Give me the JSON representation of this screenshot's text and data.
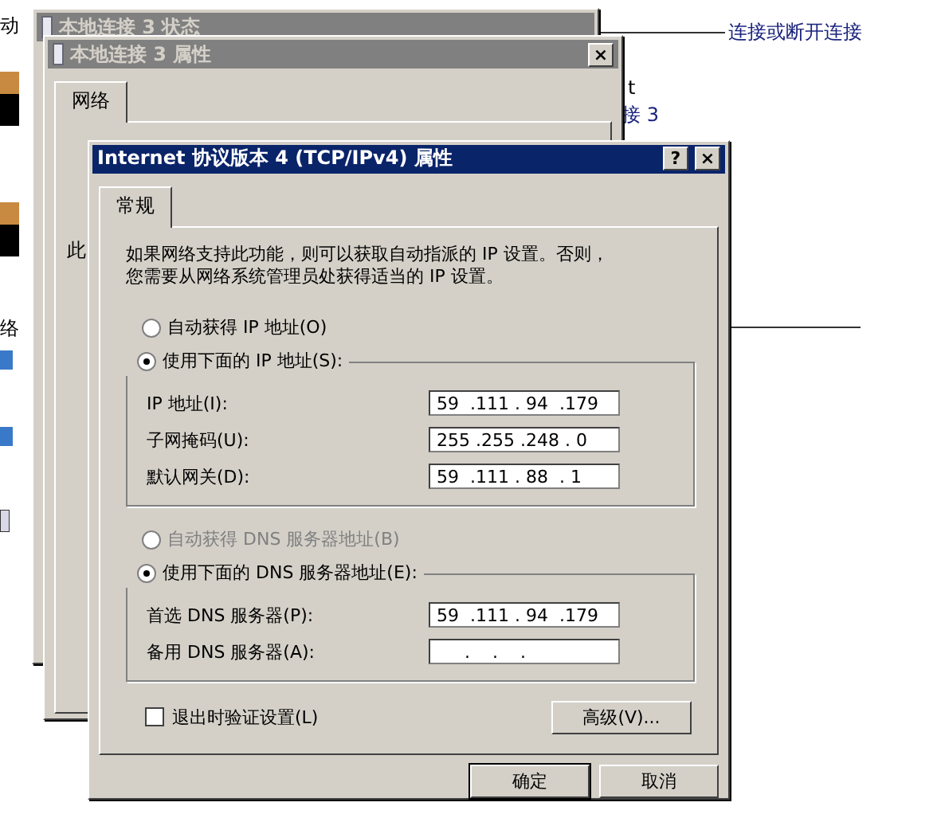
{
  "background_windows": [
    {
      "title": "本地连接 3 状态"
    },
    {
      "title": "本地连接 3 属性",
      "tabs": [
        {
          "label": "网络",
          "selected": true
        }
      ]
    }
  ],
  "background_fragments": {
    "left": [
      "动",
      "络"
    ],
    "right": [
      "t",
      "接 3"
    ],
    "inner": "此"
  },
  "callout": {
    "text": "连接或断开连接"
  },
  "dialog": {
    "title": "Internet 协议版本 4 (TCP/IPv4) 属性",
    "help": "?",
    "close": "×",
    "tabs": [
      {
        "label": "常规",
        "selected": true
      }
    ],
    "description": [
      "如果网络支持此功能，则可以获取自动指派的 IP 设置。否则，",
      "您需要从网络系统管理员处获得适当的 IP 设置。"
    ],
    "ip_options": [
      {
        "label": "自动获得 IP 地址(O)",
        "selected": false,
        "disabled": false
      },
      {
        "label": "使用下面的 IP 地址(S):",
        "selected": true,
        "disabled": false
      }
    ],
    "ip_fields": [
      {
        "label": "IP 地址(I):",
        "value": "59  .111 . 94  .179"
      },
      {
        "label": "子网掩码(U):",
        "value": "255 .255 .248 . 0"
      },
      {
        "label": "默认网关(D):",
        "value": "59  .111 . 88  . 1"
      }
    ],
    "dns_options": [
      {
        "label": "自动获得 DNS 服务器地址(B)",
        "selected": false,
        "disabled": true
      },
      {
        "label": "使用下面的 DNS 服务器地址(E):",
        "selected": true,
        "disabled": false
      }
    ],
    "dns_fields": [
      {
        "label": "首选 DNS 服务器(P):",
        "value": "59  .111 . 94  .179"
      },
      {
        "label": "备用 DNS 服务器(A):",
        "value": "     .    .    ."
      }
    ],
    "validate": {
      "label": "退出时验证设置(L)",
      "checked": false
    },
    "advanced": "高级(V)...",
    "buttons": [
      "确定",
      "取消"
    ]
  }
}
